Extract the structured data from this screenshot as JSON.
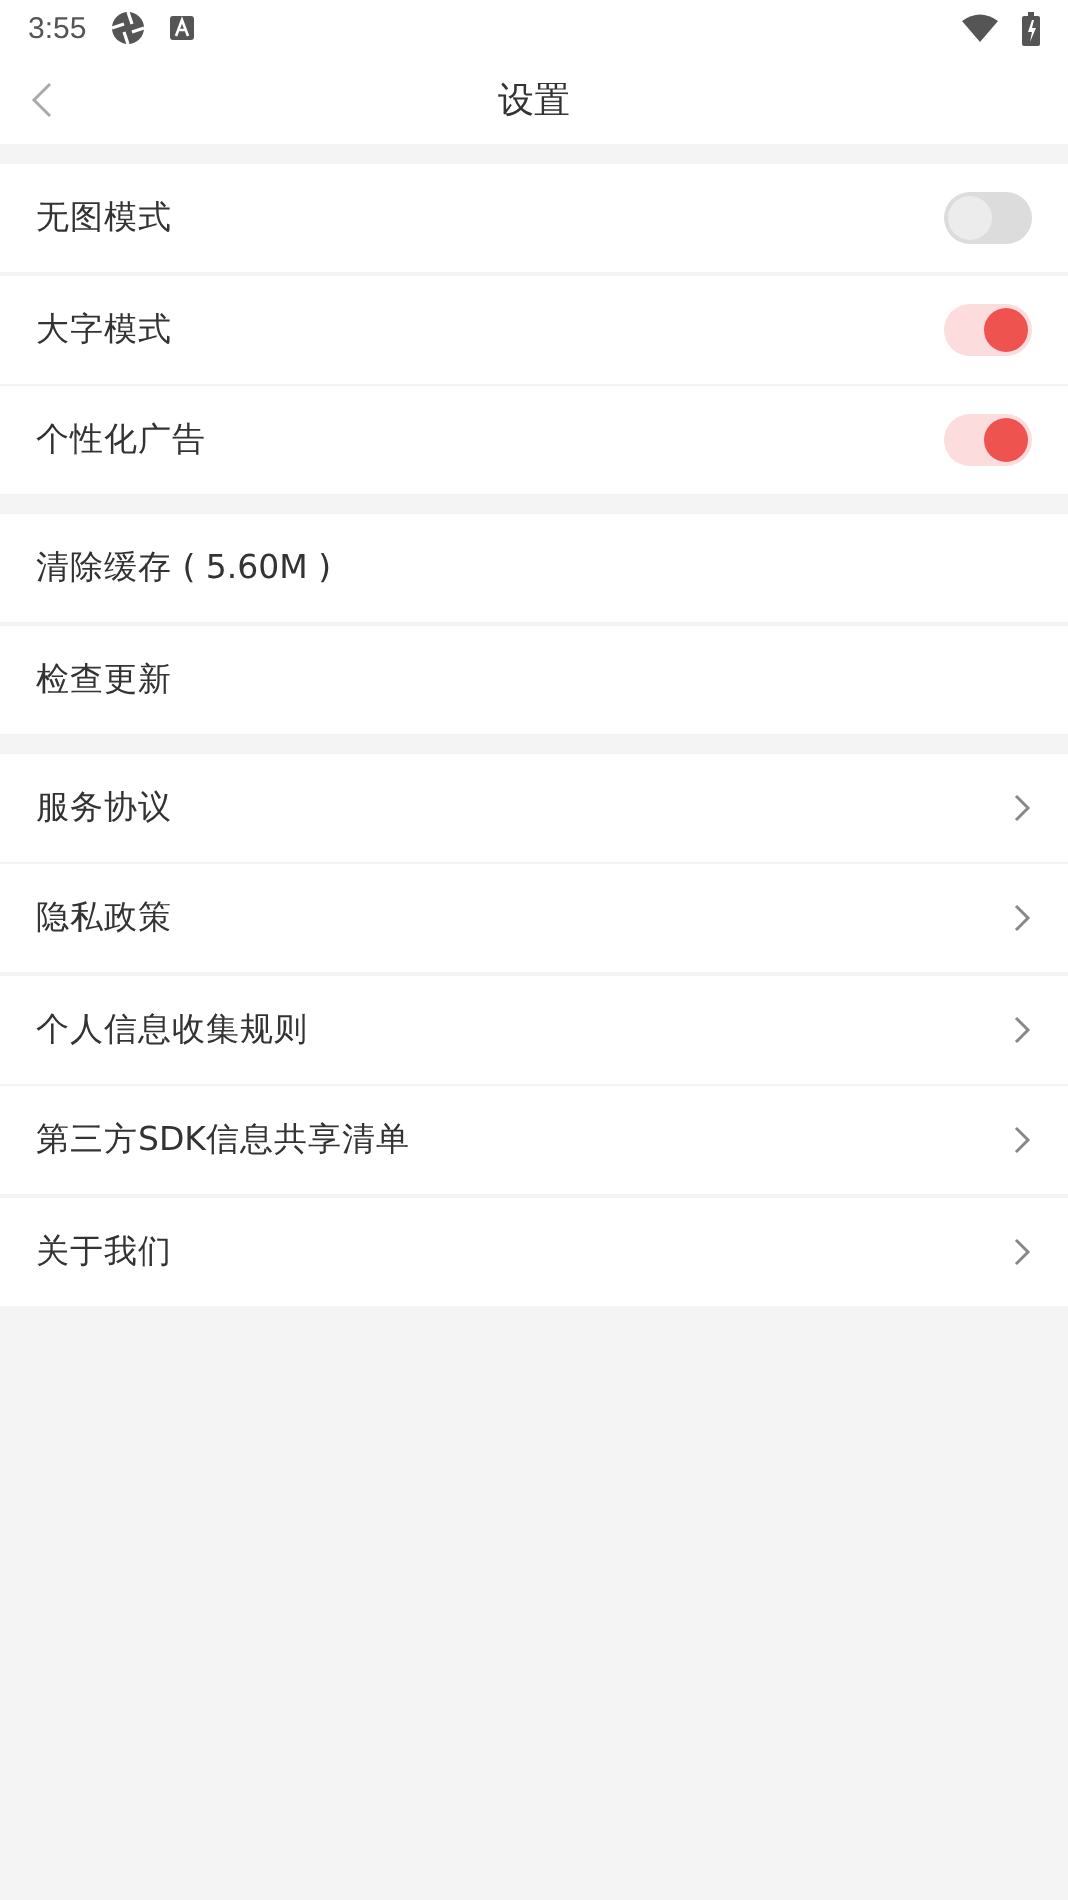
{
  "status_bar": {
    "time": "3:55"
  },
  "header": {
    "title": "设置"
  },
  "groups": [
    {
      "items": [
        {
          "kind": "toggle",
          "label": "无图模式",
          "on": false
        },
        {
          "kind": "toggle",
          "label": "大字模式",
          "on": true
        },
        {
          "kind": "toggle",
          "label": "个性化广告",
          "on": true
        }
      ]
    },
    {
      "items": [
        {
          "kind": "plain",
          "label": "清除缓存 ( 5.60M )"
        },
        {
          "kind": "plain",
          "label": "检查更新"
        }
      ]
    },
    {
      "items": [
        {
          "kind": "link",
          "label": "服务协议"
        },
        {
          "kind": "link",
          "label": "隐私政策"
        },
        {
          "kind": "link",
          "label": "个人信息收集规则"
        },
        {
          "kind": "link",
          "label": "第三方SDK信息共享清单"
        },
        {
          "kind": "link",
          "label": "关于我们"
        }
      ]
    }
  ]
}
